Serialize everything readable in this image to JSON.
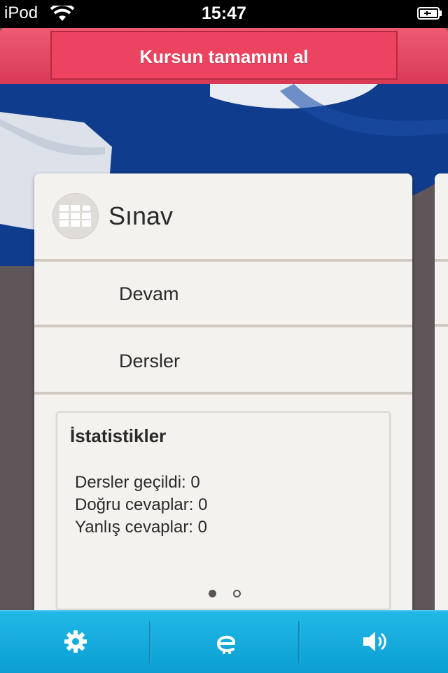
{
  "status_bar": {
    "carrier": "iPod",
    "time": "15:47"
  },
  "header": {
    "buy_button_label": "Kursun tamamını al"
  },
  "card": {
    "title": "Sınav",
    "menu": [
      {
        "label": "Devam"
      },
      {
        "label": "Dersler"
      }
    ],
    "stats": {
      "title": "İstatistikler",
      "lines": [
        "Dersler geçildi: 0",
        "Doğru cevaplar: 0",
        "Yanlış cevaplar: 0"
      ],
      "page_count": 2,
      "current_page": 1
    }
  },
  "toolbar": {
    "buttons": [
      "gear-icon",
      "language-icon",
      "speaker-icon"
    ]
  },
  "colors": {
    "header_accent": "#e8435f",
    "toolbar": "#15abdc",
    "card_bg": "#f4f2ee",
    "flag_blue": "#0f3c8c"
  }
}
